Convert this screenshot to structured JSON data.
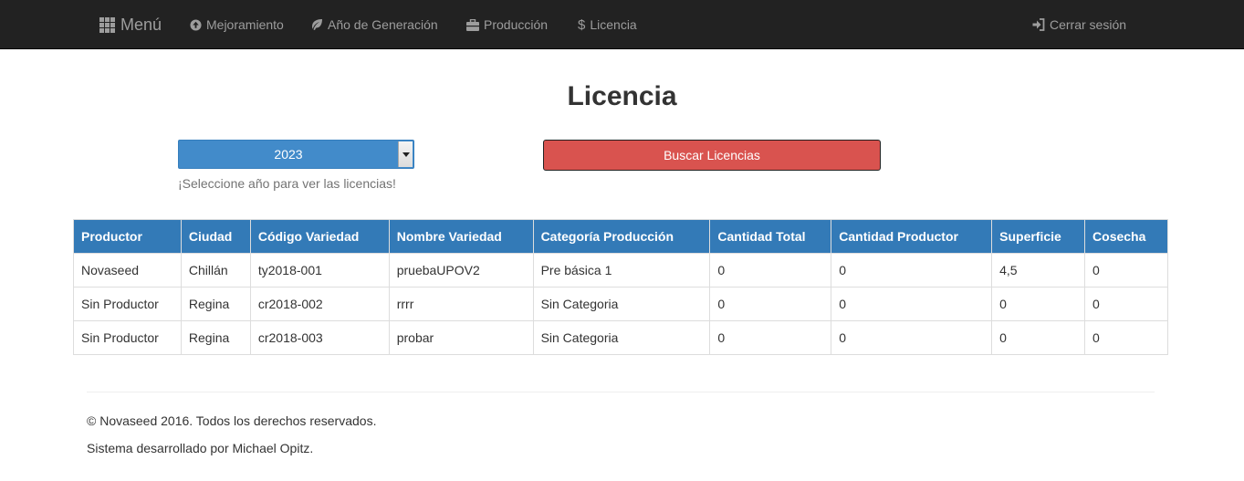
{
  "navbar": {
    "brand": {
      "label": "Menú",
      "icon": "grid-icon"
    },
    "items": [
      {
        "label": "Mejoramiento",
        "icon": "arrow-circle-up-icon"
      },
      {
        "label": "Año de Generación",
        "icon": "leaf-icon"
      },
      {
        "label": "Producción",
        "icon": "briefcase-icon"
      },
      {
        "label": "Licencia",
        "icon": "dollar-icon"
      }
    ],
    "logout": {
      "label": "Cerrar sesión",
      "icon": "log-in-icon"
    }
  },
  "page": {
    "title": "Licencia"
  },
  "filter": {
    "year_selected": "2023",
    "hint": "¡Seleccione año para ver las licencias!",
    "search_label": "Buscar Licencias"
  },
  "table": {
    "headers": [
      "Productor",
      "Ciudad",
      "Código Variedad",
      "Nombre Variedad",
      "Categoría Producción",
      "Cantidad Total",
      "Cantidad Productor",
      "Superficie",
      "Cosecha"
    ],
    "rows": [
      [
        "Novaseed",
        "Chillán",
        "ty2018-001",
        "pruebaUPOV2",
        "Pre básica 1",
        "0",
        "0",
        "4,5",
        "0"
      ],
      [
        "Sin Productor",
        "Regina",
        "cr2018-002",
        "rrrr",
        "Sin Categoria",
        "0",
        "0",
        "0",
        "0"
      ],
      [
        "Sin Productor",
        "Regina",
        "cr2018-003",
        "probar",
        "Sin Categoria",
        "0",
        "0",
        "0",
        "0"
      ]
    ]
  },
  "footer": {
    "copyright": "© Novaseed 2016. Todos los derechos reservados.",
    "credit": "Sistema desarrollado por Michael Opitz."
  },
  "colors": {
    "navbar_bg": "#222222",
    "nav_text": "#9d9d9d",
    "header_bg": "#337ab7",
    "select_bg": "#428bca",
    "danger_button": "#d9534f"
  }
}
